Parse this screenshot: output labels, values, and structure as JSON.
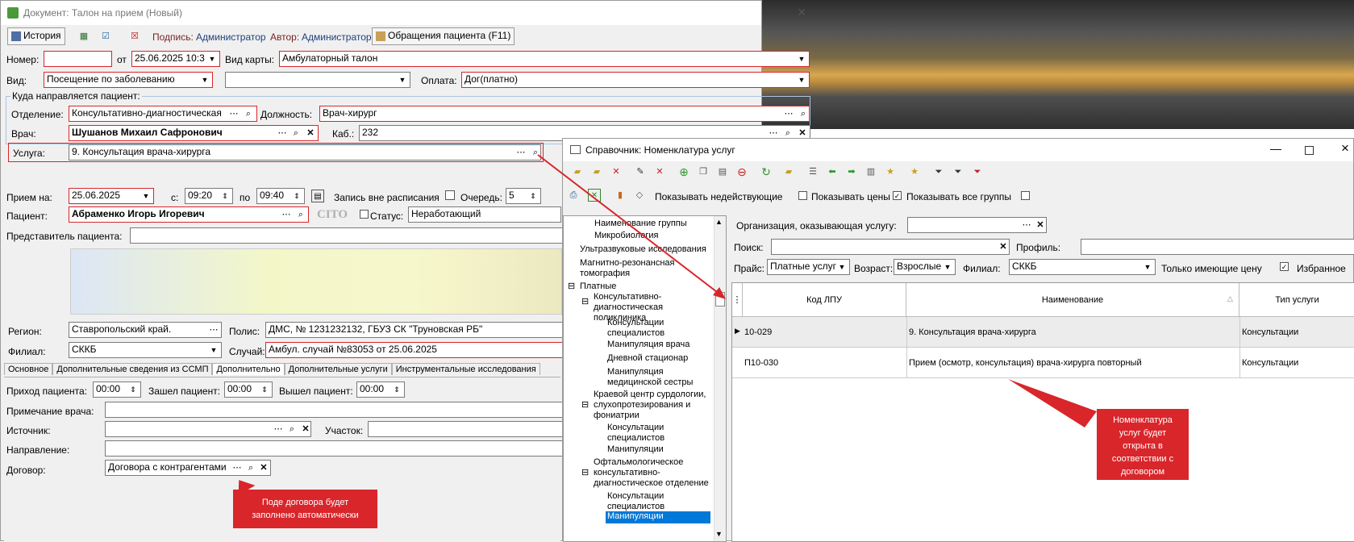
{
  "doc_window": {
    "title": "Документ: Талон на прием (Новый)",
    "toolbar": {
      "history_label": "История",
      "signature_label": "Подпись:",
      "signature_value": "Администратор",
      "author_label": "Автор:",
      "author_value": "Администратор",
      "requests_label": "Обращения пациента (F11)"
    },
    "number_label": "Номер:",
    "number_value": "",
    "from_label": "от",
    "date_value": "25.06.2025 10:3",
    "card_type_label": "Вид карты:",
    "card_type_value": "Амбулаторный талон",
    "kind_label": "Вид:",
    "kind_value": "Посещение по заболеванию",
    "kind_extra_value": "",
    "payment_label": "Оплата:",
    "payment_value": "Дог(платно)",
    "direction_group": "Куда направляется пациент:",
    "department_label": "Отделение:",
    "department_value": "Консультативно-диагностическая",
    "position_label": "Должность:",
    "position_value": "Врач-хирург",
    "doctor_label": "Врач:",
    "doctor_value": "Шушанов Михаил Сафронович",
    "cabinet_label": "Каб.:",
    "cabinet_value": "232",
    "service_label": "Услуга:",
    "service_value": "9. Консультация врача-хирурга",
    "reception_label": "Прием на:",
    "reception_date": "25.06.2025",
    "from_time_label": "с:",
    "from_time": "09:20",
    "to_time_label": "по",
    "to_time": "09:40",
    "unscheduled_label": "Запись вне расписания",
    "queue_label": "Очередь:",
    "queue_value": "5",
    "patient_label": "Пациент:",
    "patient_value": "Абраменко Игорь Игоревич",
    "cito_label": "CITO",
    "status_label": "Статус:",
    "status_value": "Неработающий",
    "representative_label": "Представитель пациента:",
    "representative_value": "",
    "region_label": "Регион:",
    "region_value": "Ставропольский край.",
    "policy_label": "Полис:",
    "policy_value": "ДМС, № 1231232132, ГБУЗ СК \"Труновская РБ\"",
    "branch_label": "Филиал:",
    "branch_value": "СККБ",
    "case_label": "Случай:",
    "case_value": "Амбул. случай №83053 от 25.06.2025",
    "tabs": [
      "Основное",
      "Дополнительные сведения из ССМП",
      "Дополнительно",
      "Дополнительные услуги",
      "Инструментальные исследования"
    ],
    "arrival_label": "Приход пациента:",
    "arrival_value": "00:00",
    "entered_label": "Зашел пациент:",
    "entered_value": "00:00",
    "left_label": "Вышел пациент:",
    "left_value": "00:00",
    "doctor_note_label": "Примечание врача:",
    "source_label": "Источник:",
    "area_label": "Участок:",
    "referral_label": "Направление:",
    "contract_label": "Договор:",
    "contract_value": "Договора с контрагентами"
  },
  "callout_contract": "Поде договора будет заполнено автоматически",
  "callout_nomenclature": "Номенклатура услуг будет открыта в соответствии с договором",
  "ref_window": {
    "title": "Справочник: Номенклатура услуг",
    "show_inactive_label": "Показывать недействующие",
    "show_prices_label": "Показывать цены",
    "show_all_groups_label": "Показывать все группы",
    "tree_header": "Наименование группы",
    "tree_items": [
      "Микробиология",
      "Ультразвуковые исследования",
      "Магнитно-резонансная томография",
      "Платные",
      "Консультативно-диагностическая поликлиника",
      "Консультации специалистов",
      "Манипуляция врача",
      "Дневной стационар",
      "Манипуляция медицинской сестры",
      "Краевой центр сурдологии, слухопротезирования и фониатрии",
      "Консультации специалистов",
      "Манипуляции",
      "Офтальмологическое консультативно-диагностическое отделение",
      "Консультации специалистов",
      "Манипуляции"
    ],
    "org_label": "Организация, оказывающая услугу:",
    "search_label": "Поиск:",
    "profile_label": "Профиль:",
    "price_label": "Прайс:",
    "price_value": "Платные услуг",
    "age_label": "Возраст:",
    "age_value": "Взрослые",
    "branch_label": "Филиал:",
    "branch_value": "СККБ",
    "only_priced_label": "Только имеющие цену",
    "favorites_label": "Избранное",
    "columns": [
      "Код ЛПУ",
      "Наименование",
      "Тип услуги"
    ],
    "rows": [
      {
        "code": "10-029",
        "name": "9. Консультация врача-хирурга",
        "type": "Консультации"
      },
      {
        "code": "П10-030",
        "name": "Прием (осмотр, консультация) врача-хирурга повторный",
        "type": "Консультации"
      }
    ]
  },
  "colors": {
    "accent_red": "#d8262b",
    "selected_blue": "#0078d7"
  }
}
